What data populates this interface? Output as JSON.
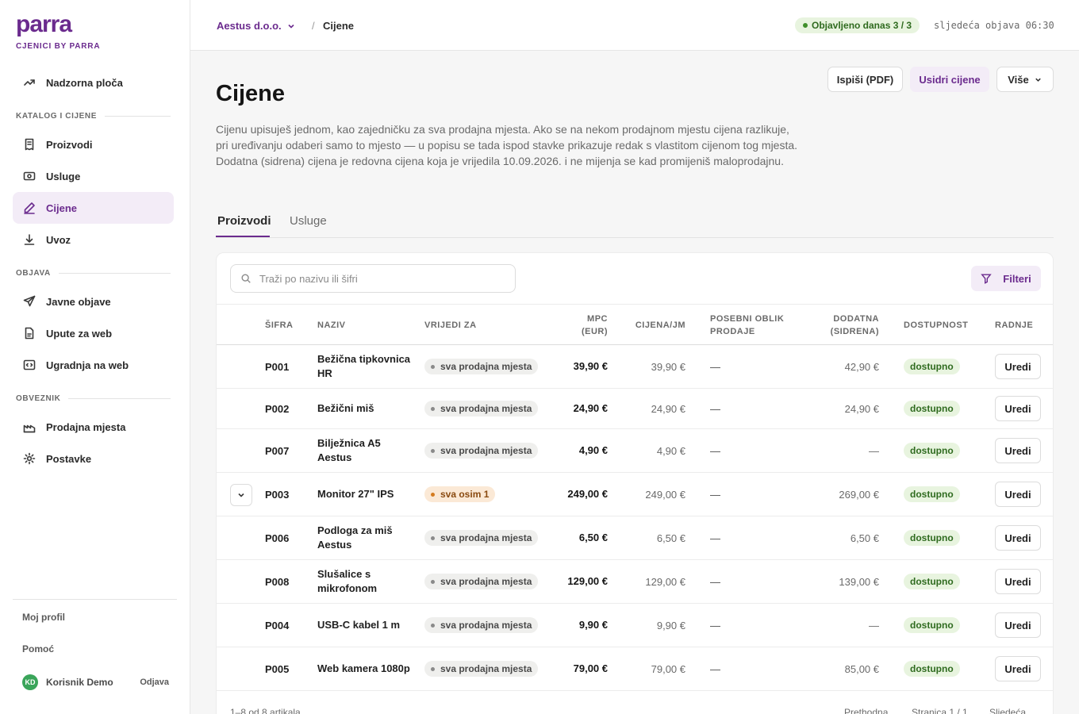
{
  "brand": {
    "logo": "parra",
    "subtitle": "CJENICI BY PARRA"
  },
  "sidebar": {
    "dashboard": "Nadzorna ploča",
    "sections": [
      {
        "label": "KATALOG I CIJENE",
        "items": [
          "Proizvodi",
          "Usluge",
          "Cijene",
          "Uvoz"
        ]
      },
      {
        "label": "OBJAVA",
        "items": [
          "Javne objave",
          "Upute za web",
          "Ugradnja na web"
        ]
      },
      {
        "label": "OBVEZNIK",
        "items": [
          "Prodajna mjesta",
          "Postavke"
        ]
      }
    ],
    "active_item": "Cijene",
    "profile": "Moj profil",
    "help": "Pomoć",
    "user": {
      "initials": "KD",
      "name": "Korisnik Demo",
      "logout": "Odjava"
    }
  },
  "topbar": {
    "company": "Aestus d.o.o.",
    "separator": "/",
    "current": "Cijene",
    "published_badge": "Objavljeno danas 3 / 3",
    "next_publication": "sljedeća objava 06:30"
  },
  "page": {
    "title": "Cijene",
    "description": "Cijenu upisuješ jednom, kao zajedničku za sva prodajna mjesta. Ako se na nekom prodajnom mjestu cijena razlikuje, pri uređivanju odaberi samo to mjesto — u popisu se tada ispod stavke prikazuje redak s vlastitom cijenom tog mjesta. Dodatna (sidrena) cijena je redovna cijena koja je vrijedila 10.09.2026. i ne mijenja se kad promijeniš maloprodajnu.",
    "buttons": {
      "pdf": "Ispiši (PDF)",
      "anchor": "Usidri cijene",
      "more": "Više"
    },
    "tabs": [
      "Proizvodi",
      "Usluge"
    ],
    "active_tab": "Proizvodi"
  },
  "table": {
    "search_placeholder": "Traži po nazivu ili šifri",
    "filters_label": "Filteri",
    "columns": {
      "sku": "ŠIFRA",
      "name": "NAZIV",
      "scope": "VRIJEDI ZA",
      "mpc": "MPC (EUR)",
      "unit_price": "CIJENA/JM",
      "special": "POSEBNI OBLIK PRODAJE",
      "anchor": "DODATNA (SIDRENA)",
      "availability": "DOSTUPNOST",
      "actions": "RADNJE"
    },
    "rows": [
      {
        "sku": "P001",
        "name": "Bežična tipkovnica HR",
        "scope": "sva prodajna mjesta",
        "scope_type": "all",
        "mpc": "39,90 €",
        "unit_price": "39,90 €",
        "special": "—",
        "anchor": "42,90 €",
        "availability": "dostupno",
        "action": "Uredi",
        "expandable": false
      },
      {
        "sku": "P002",
        "name": "Bežični miš",
        "scope": "sva prodajna mjesta",
        "scope_type": "all",
        "mpc": "24,90 €",
        "unit_price": "24,90 €",
        "special": "—",
        "anchor": "24,90 €",
        "availability": "dostupno",
        "action": "Uredi",
        "expandable": false
      },
      {
        "sku": "P007",
        "name": "Bilježnica A5 Aestus",
        "scope": "sva prodajna mjesta",
        "scope_type": "all",
        "mpc": "4,90 €",
        "unit_price": "4,90 €",
        "special": "—",
        "anchor": "—",
        "availability": "dostupno",
        "action": "Uredi",
        "expandable": false
      },
      {
        "sku": "P003",
        "name": "Monitor 27\" IPS",
        "scope": "sva osim 1",
        "scope_type": "except",
        "mpc": "249,00 €",
        "unit_price": "249,00 €",
        "special": "—",
        "anchor": "269,00 €",
        "availability": "dostupno",
        "action": "Uredi",
        "expandable": true
      },
      {
        "sku": "P006",
        "name": "Podloga za miš Aestus",
        "scope": "sva prodajna mjesta",
        "scope_type": "all",
        "mpc": "6,50 €",
        "unit_price": "6,50 €",
        "special": "—",
        "anchor": "6,50 €",
        "availability": "dostupno",
        "action": "Uredi",
        "expandable": false
      },
      {
        "sku": "P008",
        "name": "Slušalice s mikrofonom",
        "scope": "sva prodajna mjesta",
        "scope_type": "all",
        "mpc": "129,00 €",
        "unit_price": "129,00 €",
        "special": "—",
        "anchor": "139,00 €",
        "availability": "dostupno",
        "action": "Uredi",
        "expandable": false
      },
      {
        "sku": "P004",
        "name": "USB-C kabel 1 m",
        "scope": "sva prodajna mjesta",
        "scope_type": "all",
        "mpc": "9,90 €",
        "unit_price": "9,90 €",
        "special": "—",
        "anchor": "—",
        "availability": "dostupno",
        "action": "Uredi",
        "expandable": false
      },
      {
        "sku": "P005",
        "name": "Web kamera 1080p",
        "scope": "sva prodajna mjesta",
        "scope_type": "all",
        "mpc": "79,00 €",
        "unit_price": "79,00 €",
        "special": "—",
        "anchor": "85,00 €",
        "availability": "dostupno",
        "action": "Uredi",
        "expandable": false
      }
    ],
    "footer": {
      "count": "1–8 od 8 artikala",
      "prev": "Prethodna",
      "page": "Stranica 1 / 1",
      "next": "Sljedeća"
    }
  }
}
